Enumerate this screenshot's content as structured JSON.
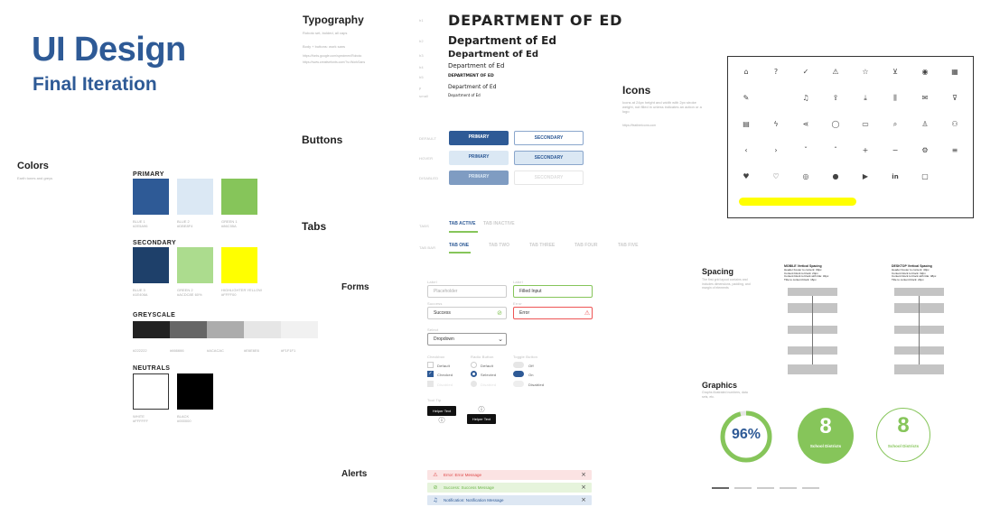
{
  "hero": {
    "title": "UI Design",
    "subtitle": "Final Iteration"
  },
  "colors": {
    "heading": "Colors",
    "desc": "Earth tones and greys",
    "primary_label": "PRIMARY",
    "secondary_label": "SECONDARY",
    "greyscale_label": "GREYSCALE",
    "neutrals_label": "NEUTRALS",
    "primary": [
      {
        "name": "BLUE 1",
        "hex": "#2E5A96",
        "code": "#2E5A96"
      },
      {
        "name": "BLUE 2",
        "hex": "#DBE8F4",
        "code": "#DBE8F4"
      },
      {
        "name": "GREEN 1",
        "hex": "#86C55A",
        "code": "#86C55A"
      }
    ],
    "secondary": [
      {
        "name": "BLUE 3",
        "hex": "#1E406A",
        "code": "#1E406A"
      },
      {
        "name": "GREEN 2",
        "hex": "#ACDC8E",
        "code": "#ACDC8E 60%"
      },
      {
        "name": "HIGHLIGHTER YELLOW",
        "hex": "#FFFF00",
        "code": "#FFFF00"
      }
    ],
    "greyscale": [
      {
        "hex": "#222222",
        "code": "#222222"
      },
      {
        "hex": "#666666",
        "code": "#666666"
      },
      {
        "hex": "#ACACAC",
        "code": "#ACACAC"
      },
      {
        "hex": "#E6E6E6",
        "code": "#E6E6E6"
      },
      {
        "hex": "#F1F1F1",
        "code": "#F1F1F1"
      }
    ],
    "neutrals": [
      {
        "name": "WHITE",
        "hex": "#FFFFFF",
        "code": "#FFFFFF"
      },
      {
        "name": "BLACK",
        "hex": "#000000",
        "code": "#000000"
      }
    ]
  },
  "typography": {
    "heading": "Typography",
    "desc1": "Roboto set, bolded, all caps",
    "desc2": "Body + buttons: work sans",
    "link1": "https://fonts.google.com/specimen/Roboto",
    "link2": "https://www.creativefonts.com/?s=WorkSans",
    "levels": [
      {
        "tag": "h1",
        "text": "DEPARTMENT OF ED"
      },
      {
        "tag": "h2",
        "text": "Department of Ed"
      },
      {
        "tag": "h3",
        "text": "Department of Ed"
      },
      {
        "tag": "h4",
        "text": "Department of Ed"
      },
      {
        "tag": "h5",
        "text": "DEPARTMENT OF ED"
      },
      {
        "tag": "p",
        "text": "Department of Ed"
      },
      {
        "tag": "small",
        "text": "Department of Ed"
      }
    ]
  },
  "buttons": {
    "heading": "Buttons",
    "states": [
      "DEFAULT",
      "HOVER",
      "DISABLED"
    ],
    "primary": "PRIMARY",
    "secondary": "SECONDARY"
  },
  "tabs": {
    "heading": "Tabs",
    "row1_label": "TABS",
    "row1": [
      "TAB ACTIVE",
      "TAB INACTIVE"
    ],
    "row2_label": "TAB BAR",
    "row2": [
      "TAB ONE",
      "TAB TWO",
      "TAB THREE",
      "TAB FOUR",
      "TAB FIVE"
    ]
  },
  "forms": {
    "heading": "Forms",
    "label_text": "Label",
    "placeholder": "Placeholder",
    "filled": "Filled Input",
    "success_lbl": "Success",
    "success": "Success",
    "error_lbl": "Error",
    "error": "Error",
    "select_lbl": "Select",
    "dropdown": "Dropdown",
    "checkbox_lbl": "Checkbox",
    "radio_lbl": "Radio Button",
    "toggle_lbl": "Toggle Button",
    "default": "Default",
    "checked": "Checked",
    "disabled": "Disabled",
    "selected": "Selected",
    "off": "Off",
    "on": "On",
    "tooltip_lbl": "Tool Tip",
    "helper": "Helper Text"
  },
  "alerts": {
    "heading": "Alerts",
    "items": [
      {
        "text": "Error: Error Message",
        "bg": "#fbe3e3",
        "color": "#d44"
      },
      {
        "text": "Success: Success Message",
        "bg": "#e6f4dc",
        "color": "#6bb548"
      },
      {
        "text": "Notification: Notification Message",
        "bg": "#dde7f3",
        "color": "#2E5A96"
      }
    ]
  },
  "icons": {
    "heading": "Icons",
    "desc": "Icons at 24px height and width with 2px stroke weight, not filled in unless indicates an action or a logo",
    "link": "https://feathericons.com",
    "rows": [
      [
        "home-icon",
        "help-icon",
        "check-circle-icon",
        "alert-icon",
        "star-icon",
        "cart-icon",
        "map-pin-icon",
        "calendar-icon"
      ],
      [
        "edit-icon",
        "",
        "bell-icon",
        "upload-cloud-icon",
        "download-icon",
        "bar-chart-icon",
        "inbox-icon",
        "filter-icon"
      ],
      [
        "map-icon",
        "zap-icon",
        "share-icon",
        "message-icon",
        "credit-card-icon",
        "search-icon",
        "user-icon",
        "users-icon"
      ],
      [
        "chevron-left-icon",
        "chevron-right-icon",
        "chevron-down-icon",
        "chevron-up-icon",
        "plus-icon",
        "minus-icon",
        "settings-icon",
        "menu-icon"
      ],
      [
        "heart-filled-icon",
        "heart-icon",
        "instagram-icon",
        "facebook-icon",
        "youtube-icon",
        "linkedin-icon",
        "comment-icon",
        ""
      ]
    ],
    "glyphs": [
      [
        "⌂",
        "?",
        "✓",
        "⚠",
        "☆",
        "⊻",
        "◉",
        "▦"
      ],
      [
        "✎",
        "",
        "♫",
        "⇪",
        "⤓",
        "⫼",
        "✉",
        "⊽"
      ],
      [
        "▤",
        "ϟ",
        "⋖",
        "◯",
        "▭",
        "⌕",
        "♙",
        "⚇"
      ],
      [
        "‹",
        "›",
        "ˇ",
        "ˆ",
        "+",
        "−",
        "⚙",
        "≡"
      ],
      [
        "♥",
        "♡",
        "◎",
        "●",
        "▶",
        "in",
        "▢",
        ""
      ]
    ]
  },
  "spacing": {
    "heading": "Spacing",
    "desc": "The first grid layout contains and includes dimensions, padding, and margin of elements",
    "mobile_title": "MOBILE Vertical Spacing",
    "desktop_title": "DESKTOP Vertical Spacing",
    "mobile_notes": "Header Footer to content: 30px\nContent block to block: 24px\nContent block to block with title: 32px\nTitle to content block: 16px",
    "desktop_notes": "Header Footer to content: 40px\nContent block to block: 32px\nContent block to block with title: 48px\nTitle to content block: 24px"
  },
  "graphics": {
    "heading": "Graphics",
    "desc": "Graphs illustrated numbers, data sets, etc.",
    "percent": 0.96,
    "percent_label": "96%",
    "count": "8",
    "count_label": "School Districts",
    "green": "#86C55A"
  }
}
